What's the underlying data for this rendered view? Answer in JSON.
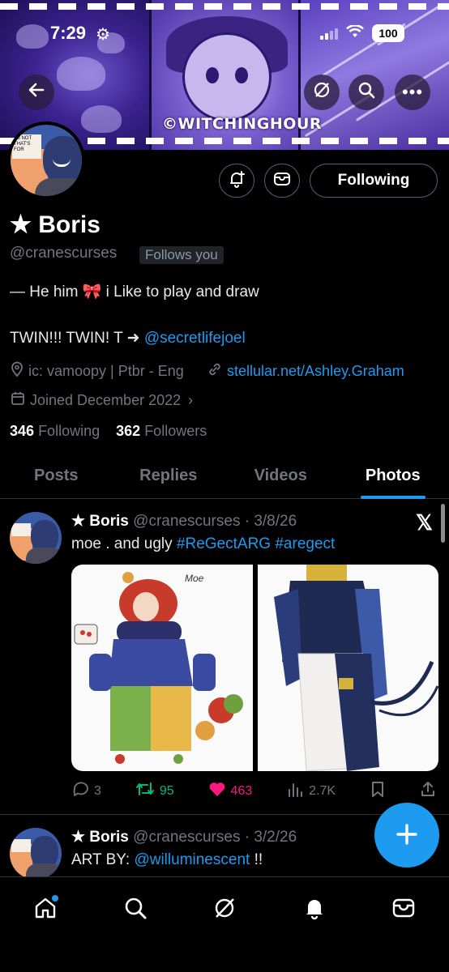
{
  "status_bar": {
    "time": "7:29",
    "battery": "100"
  },
  "banner": {
    "watermark": "©WITCHINGHOUR"
  },
  "profile": {
    "display_name": "★ Boris",
    "handle": "@cranescurses",
    "follows_you": "Follows you",
    "follow_button": "Following",
    "bio_line1": "— He him 🎀 i Like to play and draw",
    "bio_line2_prefix": "TWIN!!! TWIN! T ➜ ",
    "bio_line2_link": "@secretlifejoel",
    "location": "ic: vamoopy | Ptbr - Eng",
    "website": "stellular.net/Ashley.Graham",
    "joined": "Joined December 2022",
    "following_count": "346",
    "following_label": "Following",
    "followers_count": "362",
    "followers_label": "Followers"
  },
  "tabs": [
    {
      "label": "Posts"
    },
    {
      "label": "Replies"
    },
    {
      "label": "Videos"
    },
    {
      "label": "Photos",
      "active": true
    }
  ],
  "posts": [
    {
      "name": "★ Boris",
      "handle_date": "@cranescurses · 3/8/26",
      "text_prefix": "moe . and ugly ",
      "hashtag1": "#ReGectARG",
      "hashtag2": "#aregect",
      "media_caption": "Moe",
      "replies": "3",
      "reposts": "95",
      "likes": "463",
      "views": "2.7K"
    },
    {
      "name": "★ Boris",
      "handle_date": "@cranescurses · 3/2/26",
      "text_prefix": "ART BY: ",
      "mention": "@willuminescent",
      "text_suffix": " !!"
    }
  ],
  "colors": {
    "accent": "#1d9bf0",
    "like": "#f91880",
    "repost": "#00ba7c",
    "muted": "#71767b"
  },
  "icons": [
    "back-arrow-icon",
    "grok-icon",
    "search-icon",
    "more-icon",
    "add-notification-icon",
    "mail-icon",
    "location-icon",
    "link-icon",
    "calendar-icon",
    "x-logo-icon",
    "reply-icon",
    "repost-icon",
    "like-icon",
    "views-icon",
    "bookmark-icon",
    "share-icon",
    "compose-icon",
    "home-icon",
    "bell-icon"
  ]
}
